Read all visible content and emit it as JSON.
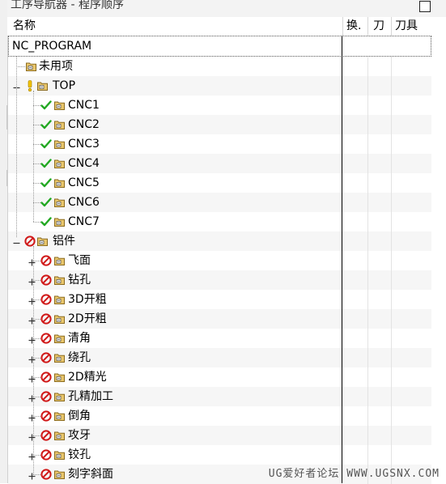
{
  "window": {
    "title": "工序导航器 - 程序顺序"
  },
  "columns": {
    "name": "名称",
    "c1": "换.",
    "c2": "刀",
    "c3": "刀具"
  },
  "root": {
    "label": "NC_PROGRAM"
  },
  "tree": [
    {
      "label": "未用项",
      "depth": 1,
      "status": "none",
      "expander": "none"
    },
    {
      "label": "TOP",
      "depth": 1,
      "status": "warning",
      "expander": "minus"
    },
    {
      "label": "CNC1",
      "depth": 2,
      "status": "ok",
      "expander": "none"
    },
    {
      "label": "CNC2",
      "depth": 2,
      "status": "ok",
      "expander": "none"
    },
    {
      "label": "CNC3",
      "depth": 2,
      "status": "ok",
      "expander": "none"
    },
    {
      "label": "CNC4",
      "depth": 2,
      "status": "ok",
      "expander": "none"
    },
    {
      "label": "CNC5",
      "depth": 2,
      "status": "ok",
      "expander": "none"
    },
    {
      "label": "CNC6",
      "depth": 2,
      "status": "ok",
      "expander": "none"
    },
    {
      "label": "CNC7",
      "depth": 2,
      "status": "ok",
      "expander": "none"
    },
    {
      "label": "铝件",
      "depth": 1,
      "status": "blocked",
      "expander": "minus"
    },
    {
      "label": "飞面",
      "depth": 2,
      "status": "blocked",
      "expander": "plus"
    },
    {
      "label": "钻孔",
      "depth": 2,
      "status": "blocked",
      "expander": "plus"
    },
    {
      "label": "3D开粗",
      "depth": 2,
      "status": "blocked",
      "expander": "plus"
    },
    {
      "label": "2D开粗",
      "depth": 2,
      "status": "blocked",
      "expander": "plus"
    },
    {
      "label": "清角",
      "depth": 2,
      "status": "blocked",
      "expander": "plus"
    },
    {
      "label": "绕孔",
      "depth": 2,
      "status": "blocked",
      "expander": "plus"
    },
    {
      "label": "2D精光",
      "depth": 2,
      "status": "blocked",
      "expander": "plus"
    },
    {
      "label": "孔精加工",
      "depth": 2,
      "status": "blocked",
      "expander": "plus"
    },
    {
      "label": "倒角",
      "depth": 2,
      "status": "blocked",
      "expander": "plus"
    },
    {
      "label": "攻牙",
      "depth": 2,
      "status": "blocked",
      "expander": "plus"
    },
    {
      "label": "铰孔",
      "depth": 2,
      "status": "blocked",
      "expander": "plus"
    },
    {
      "label": "刻字斜面",
      "depth": 2,
      "status": "blocked",
      "expander": "plus"
    }
  ],
  "watermark": "UG爱好者论坛 WWW.UGSNX.COM",
  "colors": {
    "ok": "#22a822",
    "warning": "#f2c200",
    "blocked": "#d01818",
    "folder": "#e9c66b"
  }
}
